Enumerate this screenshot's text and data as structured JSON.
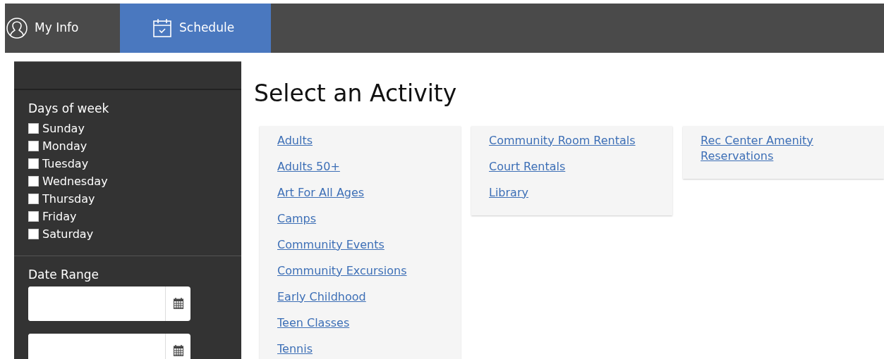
{
  "tabs": [
    {
      "label": "My Info",
      "kind": "profile",
      "selected": false
    },
    {
      "label": "Schedule",
      "kind": "schedule",
      "selected": true
    }
  ],
  "sidebar": {
    "days_title": "Days of week",
    "days": [
      {
        "label": "Sunday",
        "checked": false
      },
      {
        "label": "Monday",
        "checked": false
      },
      {
        "label": "Tuesday",
        "checked": false
      },
      {
        "label": "Wednesday",
        "checked": false
      },
      {
        "label": "Thursday",
        "checked": false
      },
      {
        "label": "Friday",
        "checked": false
      },
      {
        "label": "Saturday",
        "checked": false
      }
    ],
    "date_range_title": "Date Range"
  },
  "title": "Select an Activity",
  "columns": [
    [
      "Adults",
      "Adults 50+",
      "Art For All Ages",
      "Camps",
      "Community Events",
      "Community Excursions",
      "Early Childhood",
      "Teen Classes",
      "Tennis"
    ],
    [
      "Community Room Rentals",
      "Court Rentals",
      "Library"
    ],
    [
      "Rec Center Amenity Reservations"
    ]
  ]
}
